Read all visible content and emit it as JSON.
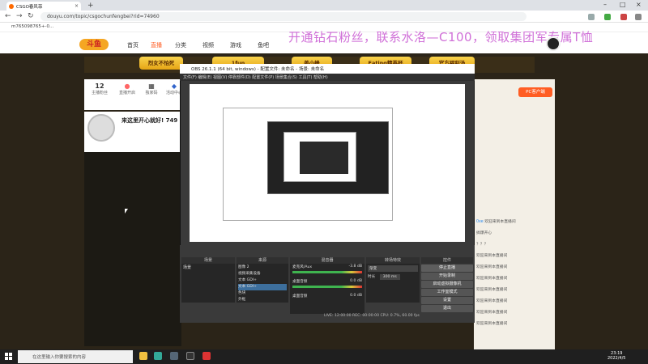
{
  "browser": {
    "tab_title": "CSGO春风菲",
    "url": "douyu.com/topic/csgochunfengbei?rid=74960",
    "bookmark": "m765098765+-0..."
  },
  "site": {
    "nav": [
      "首页",
      "直播",
      "分类",
      "视频",
      "游戏",
      "鱼吧"
    ],
    "promo_banner": "开通钻石粉丝，联系水洛—C100，领取集团军专属T恤",
    "gold_buttons": [
      "烈女不怕死",
      "1fun",
      "姜小峰",
      "Eating精英杯",
      "官方福利汤"
    ],
    "stats": [
      {
        "value": "12",
        "label": "主播粉丝"
      },
      {
        "value": "",
        "label": "直播开启"
      },
      {
        "value": "",
        "label": "独家码"
      },
      {
        "value": "",
        "label": "活动中心"
      }
    ],
    "streamer_title": "来这里开心就好! 749",
    "pc_button": "PC客户端",
    "chat": [
      {
        "name": "0xe",
        "text": "欢迎来到本直播间"
      },
      {
        "name": "",
        "text": "搞爆开心"
      },
      {
        "name": "",
        "text": "？？？"
      },
      {
        "name": "",
        "text": "欢迎来到本直播间"
      },
      {
        "name": "",
        "text": "欢迎来到本直播间"
      },
      {
        "name": "",
        "text": "欢迎来到本直播间"
      },
      {
        "name": "",
        "text": "欢迎来到本直播间"
      },
      {
        "name": "",
        "text": "欢迎来到本直播间"
      },
      {
        "name": "",
        "text": "欢迎来到本直播间"
      },
      {
        "name": "",
        "text": "欢迎来到本直播间"
      }
    ]
  },
  "obs": {
    "title": "OBS 26.1.1 (64 bit, windows) - 配置文件: 未命名 - 场景: 未命名",
    "menu": "文件(F)  编辑(E)  视图(V)  停靠部件(D)  配置文件(P)  场景集合(S)  工具(T)  帮助(H)",
    "panels": [
      "场景",
      "来源",
      "混音器",
      "转场特效",
      "控件"
    ],
    "scene": "场景",
    "sources": [
      "图像 2",
      "视频采集设备",
      "文本 GDI+",
      "文本 GDI+",
      "色块",
      "外框"
    ],
    "mixer": [
      {
        "label": "麦克风/Aux",
        "db": "-3.8 dB"
      },
      {
        "label": "桌面音频",
        "db": "0.0 dB"
      },
      {
        "label": "桌面音频",
        "db": "0.0 dB"
      }
    ],
    "transition": "渐变",
    "duration_label": "时长",
    "duration": "300 ms",
    "controls": [
      "停止直播",
      "开始录制",
      "启动虚拟摄像机",
      "工作室模式",
      "设置",
      "退出"
    ],
    "status": "LIVE: 12:00:00  REC: 00:00:00  CPU: 0.7%, 60.00 fps"
  },
  "taskbar": {
    "search": "在这里输入你要搜索的内容",
    "time": "23:19",
    "date": "2022/4/5"
  }
}
